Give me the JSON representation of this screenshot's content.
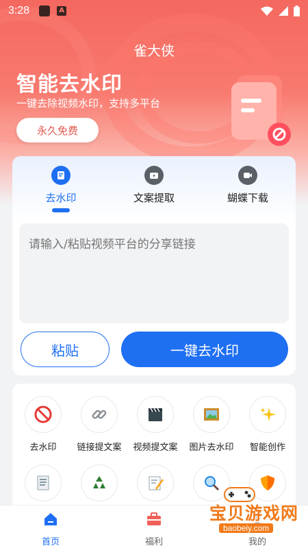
{
  "status_bar": {
    "time": "3:28"
  },
  "app": {
    "title": "雀大侠"
  },
  "hero": {
    "title": "智能去水印",
    "subtitle": "一键去除视频水印，支持多平台",
    "button_label": "永久免费"
  },
  "tabs": [
    {
      "label": "去水印",
      "icon": "watermark-stamp-icon",
      "active": true
    },
    {
      "label": "文案提取",
      "icon": "video-text-icon",
      "active": false
    },
    {
      "label": "蝴蝶下载",
      "icon": "video-download-icon",
      "active": false
    }
  ],
  "input": {
    "placeholder": "请输入/粘贴视频平台的分享链接",
    "value": ""
  },
  "actions": {
    "paste_label": "粘贴",
    "remove_label": "一键去水印"
  },
  "tools": [
    {
      "label": "去水印",
      "icon": "no-sign-icon"
    },
    {
      "label": "链接提文案",
      "icon": "link-icon"
    },
    {
      "label": "视频提文案",
      "icon": "clapper-icon"
    },
    {
      "label": "图片去水印",
      "icon": "picture-icon"
    },
    {
      "label": "智能创作",
      "icon": "sparkles-icon"
    },
    {
      "label": "",
      "icon": "notepad-icon"
    },
    {
      "label": "",
      "icon": "recycle-icon"
    },
    {
      "label": "",
      "icon": "memo-icon"
    },
    {
      "label": "",
      "icon": "magnifier-icon"
    },
    {
      "label": "",
      "icon": "shield-icon"
    }
  ],
  "bottom_nav": [
    {
      "label": "首页",
      "icon": "home-icon",
      "active": true
    },
    {
      "label": "福利",
      "icon": "toolbox-icon",
      "active": false
    },
    {
      "label": "我的",
      "icon": "profile-icon",
      "active": false
    }
  ],
  "watermark": {
    "text": "宝贝游戏网",
    "url": "baobeiy.com"
  },
  "colors": {
    "accent": "#1e6ff2",
    "hero": "#f4685f",
    "background": "#f2f3f5"
  }
}
